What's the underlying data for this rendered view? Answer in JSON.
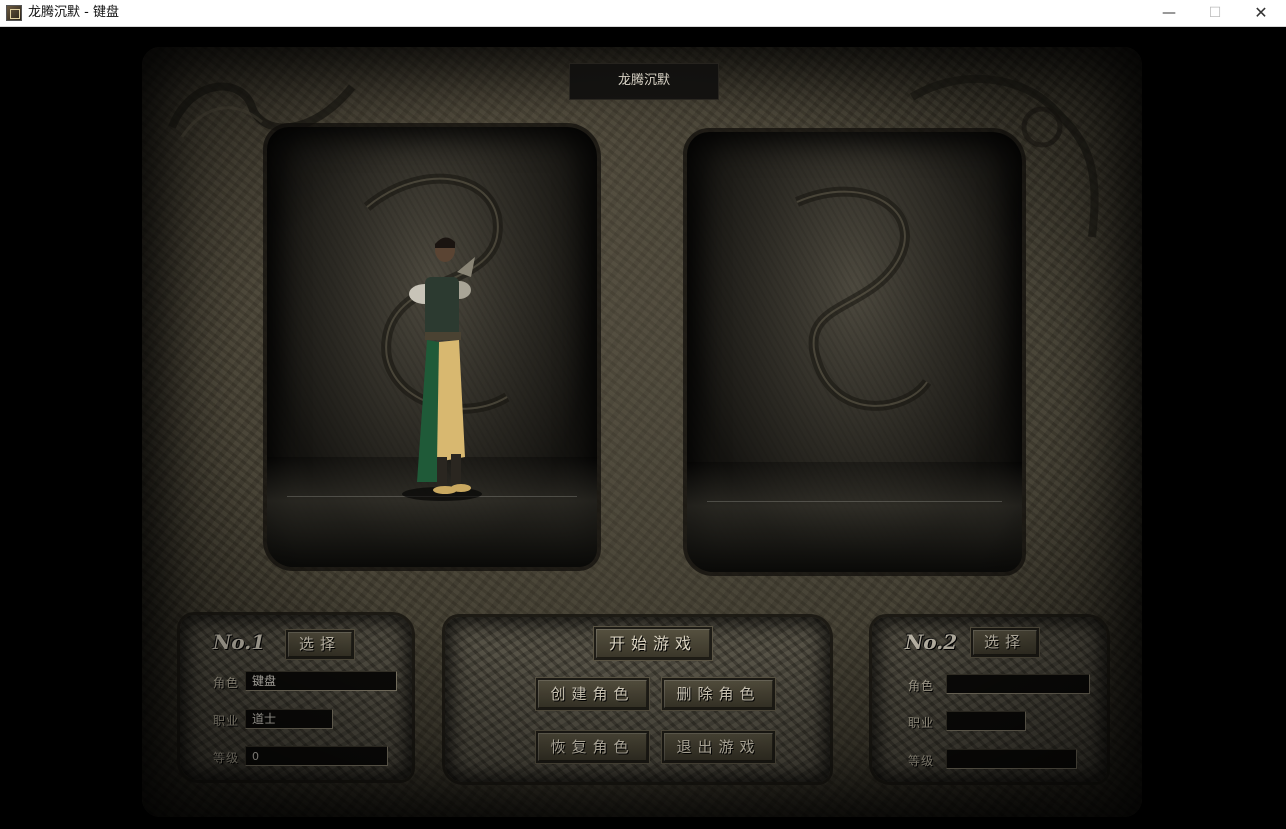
{
  "window": {
    "title": "龙腾沉默 - 键盘",
    "minimize_glyph": "—",
    "maximize_glyph": "☐",
    "close_glyph": "✕",
    "icon": "game-app-icon"
  },
  "server_title": "龙腾沉默",
  "slot1": {
    "label": "No.1",
    "select_label": "选择",
    "role_label": "角色",
    "role_value": "键盘",
    "job_label": "职业",
    "job_value": "道士",
    "level_label": "等级",
    "level_value": "0"
  },
  "slot2": {
    "label": "No.2",
    "select_label": "选择",
    "role_label": "角色",
    "role_value": "",
    "job_label": "职业",
    "job_value": "",
    "level_label": "等级",
    "level_value": ""
  },
  "actions": {
    "start": "开始游戏",
    "create": "创建角色",
    "delete": "删除角色",
    "restore": "恢复角色",
    "exit": "退出游戏"
  },
  "colors": {
    "stone": "#3a3629",
    "text": "#d9d2c0",
    "field_bg": "#0c0b09"
  }
}
